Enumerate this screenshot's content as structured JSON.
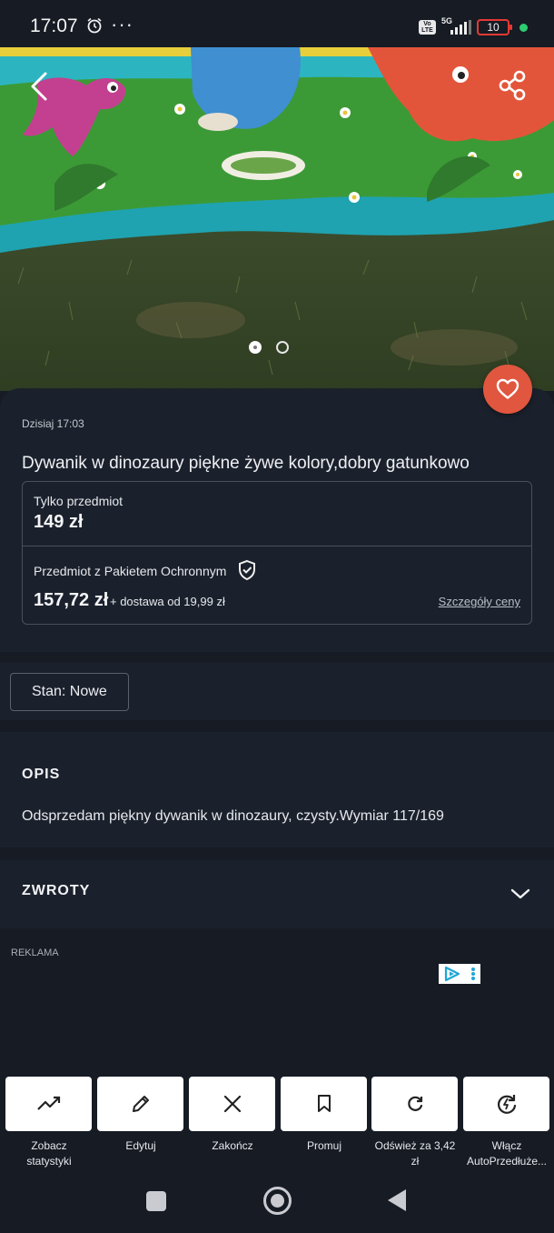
{
  "status_bar": {
    "time": "17:07",
    "more": "···",
    "volte": "Vo LTE",
    "network": "5G",
    "battery": "10",
    "colors": {
      "battery_low": "#e53935",
      "active_dot": "#2ecc71"
    }
  },
  "gallery": {
    "total_photos": 2,
    "active_photo": 1,
    "icons": {
      "back": "chevron-left-icon",
      "share": "share-icon",
      "favorite": "heart-icon"
    }
  },
  "listing": {
    "date": "Dzisiaj 17:03",
    "title": "Dywanik w dinozaury piękne żywe kolory,dobry gatunkowo",
    "price_item_label": "Tylko przedmiot",
    "price_item": "149 zł",
    "price_protected_label": "Przedmiot z Pakietem Ochronnym",
    "price_protected": "157,72 zł",
    "shipping": "+ dostawa od 19,99 zł",
    "price_details_link": "Szczegóły ceny",
    "condition": "Stan: Nowe"
  },
  "description": {
    "heading": "OPIS",
    "text": "Odsprzedam piękny dywanik w dinozaury, czysty.Wymiar 117/169"
  },
  "returns": {
    "heading": "ZWROTY"
  },
  "ad": {
    "label": "REKLAMA"
  },
  "actions": [
    {
      "line1": "Zobacz",
      "line2": "statystyki",
      "icon": "trending-up-icon"
    },
    {
      "line1": "Edytuj",
      "line2": "",
      "icon": "pencil-icon"
    },
    {
      "line1": "Zakończ",
      "line2": "",
      "icon": "close-icon"
    },
    {
      "line1": "Promuj",
      "line2": "",
      "icon": "bookmark-icon"
    },
    {
      "line1": "Odśwież za 3,42",
      "line2": "zł",
      "icon": "refresh-icon"
    },
    {
      "line1": "Włącz",
      "line2": "AutoPrzedłuże...",
      "icon": "auto-renew-icon"
    }
  ],
  "colors": {
    "background": "#161b24",
    "card": "#1b212c",
    "favorite": "#e0563f"
  }
}
